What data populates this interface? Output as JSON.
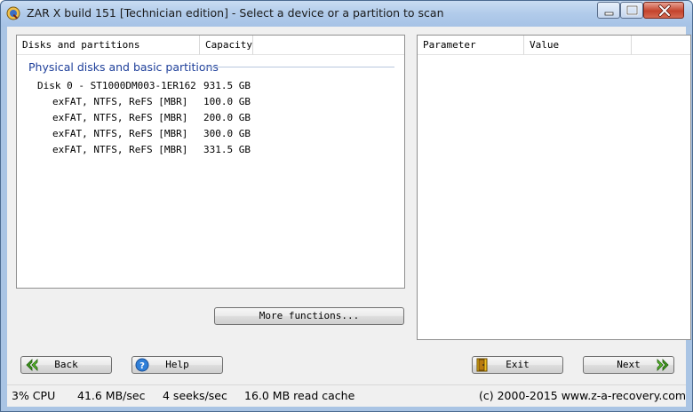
{
  "window": {
    "title": "ZAR X build 151 [Technician edition] - Select a device or a partition to scan"
  },
  "left_panel": {
    "columns": [
      "Disks and partitions",
      "Capacity"
    ],
    "group_title": "Physical disks and basic partitions",
    "rows": [
      {
        "name": "Disk 0 - ST1000DM003-1ER162",
        "capacity": "931.5 GB"
      },
      {
        "name": "exFAT, NTFS, ReFS [MBR]",
        "capacity": "100.0 GB"
      },
      {
        "name": "exFAT, NTFS, ReFS [MBR]",
        "capacity": "200.0 GB"
      },
      {
        "name": "exFAT, NTFS, ReFS [MBR]",
        "capacity": "300.0 GB"
      },
      {
        "name": "exFAT, NTFS, ReFS [MBR]",
        "capacity": "331.5 GB"
      }
    ],
    "more_functions_label": "More functions..."
  },
  "right_panel": {
    "columns": [
      "Parameter",
      "Value"
    ]
  },
  "buttons": {
    "back": "Back",
    "help": "Help",
    "exit": "Exit",
    "next": "Next"
  },
  "icons": {
    "back": "double-left-arrow-icon",
    "help": "question-mark-icon",
    "exit": "door-exit-icon",
    "next": "double-right-arrow-icon"
  },
  "status": {
    "cpu": "3% CPU",
    "speed": "41.6 MB/sec",
    "seeks": "4 seeks/sec",
    "cache": "16.0 MB read cache",
    "copyright": "(c) 2000-2015 www.z-a-recovery.com"
  },
  "colors": {
    "group_title": "#1e3f9a",
    "title_bar": "#b1cbea",
    "close_button": "#c4432c"
  }
}
